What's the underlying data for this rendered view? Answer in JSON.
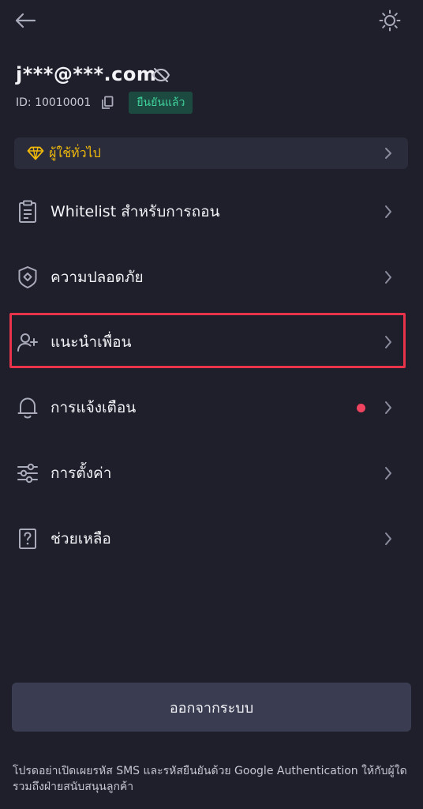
{
  "header": {
    "back_icon": "arrow-left-icon",
    "theme_icon": "sun-icon"
  },
  "profile": {
    "email": "j***@***.com",
    "uid": "ID: 10010001",
    "verified_label": "ยืนยันแล้ว"
  },
  "vip": {
    "label": "ผู้ใช้ทั่วไป",
    "icon": "diamond-icon",
    "accent": "#f0b90b"
  },
  "menu": [
    {
      "label": "Whitelist สำหรับการถอน",
      "icon": "clipboard-list-icon"
    },
    {
      "label": "ความปลอดภัย",
      "icon": "shield-icon"
    },
    {
      "label": "แนะนำเพื่อน",
      "icon": "user-plus-icon"
    },
    {
      "label": "การแจ้งเตือน",
      "icon": "bell-icon"
    },
    {
      "label": "การตั้งค่า",
      "icon": "sliders-icon"
    },
    {
      "label": "ช่วยเหลือ",
      "icon": "help-icon"
    }
  ],
  "logout": {
    "label": "ออกจากระบบ"
  },
  "footer": {
    "note": "โปรดอย่าเปิดเผยรหัส SMS และรหัสยืนยันด้วย Google Authentication ให้กับผู้ใด รวมถึงฝ่ายสนับสนุนลูกค้า"
  },
  "colors": {
    "background": "#1e1f2b",
    "verified": "#3fd29b",
    "notification_dot": "#f0435f",
    "highlight": "#e8334a"
  }
}
